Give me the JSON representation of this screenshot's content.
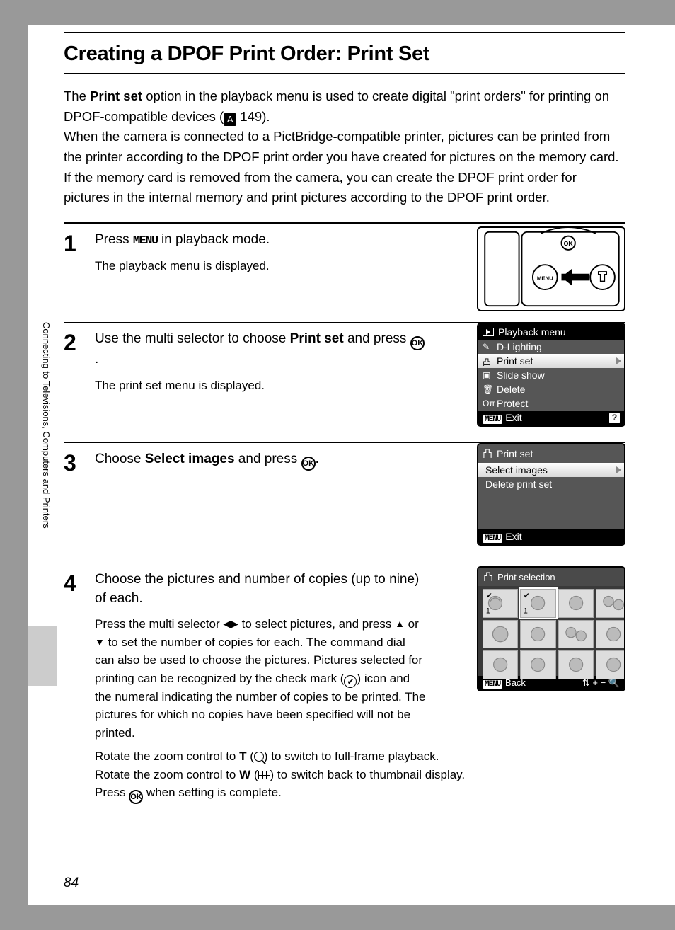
{
  "sidebar_text": "Connecting to Televisions, Computers and Printers",
  "page_number": "84",
  "title": "Creating a DPOF Print Order: Print Set",
  "intro": {
    "t1a": "The ",
    "t1b": "Print set",
    "t1c": " option in the playback menu is used to create digital \"print orders\" for printing on DPOF-compatible devices (",
    "ref_icon": "A",
    "ref_num": " 149).",
    "t2": "When the camera is connected to a PictBridge-compatible printer, pictures can be printed from the printer according to the DPOF print order you have created for pictures on the memory card. If the memory card is removed from the camera, you can create the DPOF print order for pictures in the internal memory and print pictures according to the DPOF print order."
  },
  "steps": {
    "s1": {
      "num": "1",
      "head_a": "Press ",
      "head_menu": "MENU",
      "head_b": " in playback mode.",
      "sub": "The playback menu is displayed."
    },
    "s2": {
      "num": "2",
      "head_a": "Use the multi selector to choose ",
      "head_b": "Print set",
      "head_c": " and press ",
      "head_d": ".",
      "sub": "The print set menu is displayed.",
      "screen_title": "Playback menu",
      "items": [
        "D-Lighting",
        "Print set",
        "Slide show",
        "Delete",
        "Protect"
      ],
      "selected": 1,
      "exit": "Exit"
    },
    "s3": {
      "num": "3",
      "head_a": "Choose ",
      "head_b": "Select images",
      "head_c": " and press ",
      "head_d": ".",
      "screen_title": "Print set",
      "items": [
        "Select images",
        "Delete print set"
      ],
      "selected": 0,
      "exit": "Exit"
    },
    "s4": {
      "num": "4",
      "head": "Choose the pictures and number of copies (up to nine) of each.",
      "sub1a": "Press the multi selector ",
      "sub1b": " to select pictures, and press ",
      "sub1c": " or ",
      "sub1d": " to set the number of copies for each. The command dial can also be used to choose the pictures. Pictures selected for printing can be recognized by the check mark (",
      "sub1e": ") icon and the numeral indicating the number of copies to be printed. The pictures for which no copies have been specified will not be printed.",
      "sub2a": "Rotate the zoom control to ",
      "sub2b": "T",
      "sub2c": " (",
      "sub2d": ") to switch to full-frame playback.",
      "sub3a": "Rotate the zoom control to ",
      "sub3b": "W",
      "sub3c": " (",
      "sub3d": ") to switch back to thumbnail display.",
      "sub4a": "Press ",
      "sub4b": " when setting is complete.",
      "screen_title": "Print selection",
      "back": "Back",
      "foot_right": "+ −"
    }
  },
  "icons": {
    "ok": "OK",
    "menu_box": "MENU",
    "check": "✔",
    "help": "?"
  }
}
